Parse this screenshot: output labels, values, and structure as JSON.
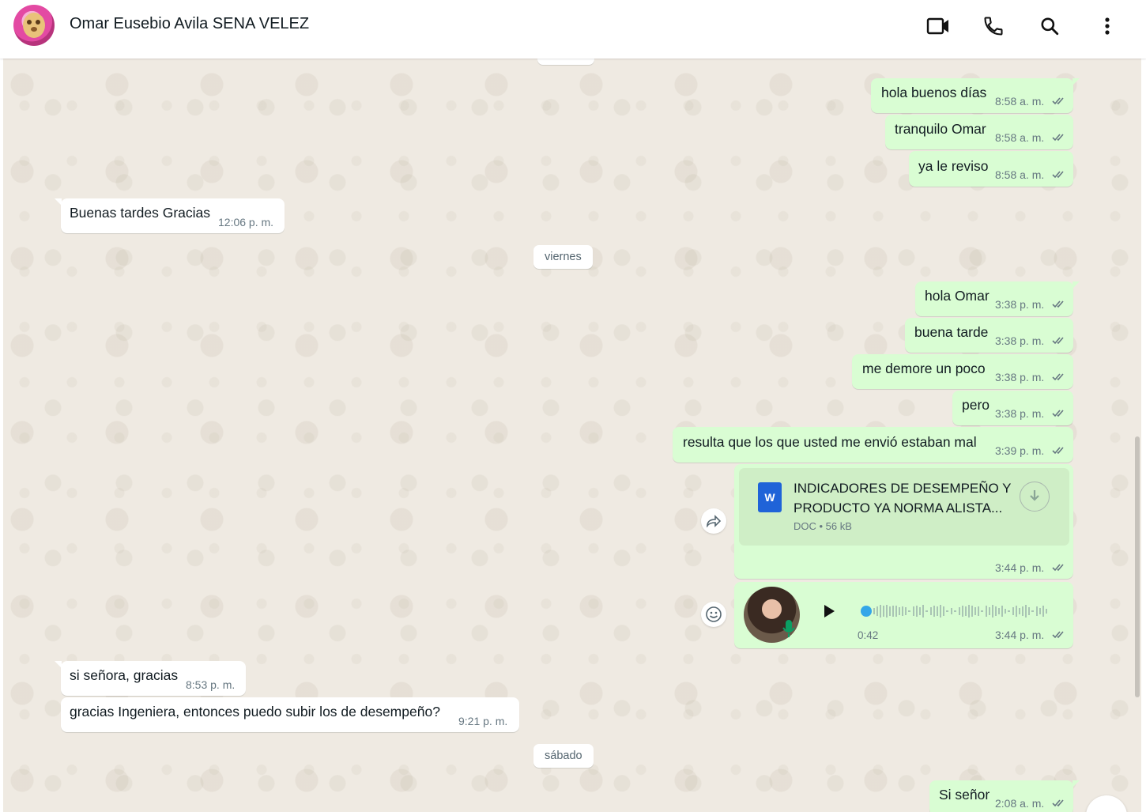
{
  "header": {
    "contact_name": "Omar Eusebio Avila SENA VELEZ",
    "icons": [
      "video-call-icon",
      "voice-call-icon",
      "search-icon",
      "menu-icon"
    ]
  },
  "colors": {
    "outgoing_bubble": "#d9fdd3",
    "incoming_bubble": "#ffffff",
    "chat_background": "#efeae2",
    "tick_color": "#667781"
  },
  "messages": {
    "m1": {
      "text": "hola buenos días",
      "time": "8:58 a. m."
    },
    "m2": {
      "text": "tranquilo Omar",
      "time": "8:58 a. m."
    },
    "m3": {
      "text": "ya le reviso",
      "time": "8:58 a. m."
    },
    "m4": {
      "text": "Buenas tardes Gracias",
      "time": "12:06 p. m."
    },
    "day1": "viernes",
    "m5": {
      "text": "hola Omar",
      "time": "3:38 p. m."
    },
    "m6": {
      "text": "buena tarde",
      "time": "3:38 p. m."
    },
    "m7": {
      "text": "me demore un poco",
      "time": "3:38 p. m."
    },
    "m8": {
      "text": "pero",
      "time": "3:38 p. m."
    },
    "m9": {
      "text": "resulta que los que usted me envió estaban mal",
      "time": "3:39 p. m."
    },
    "doc": {
      "title_line1": "INDICADORES DE DESEMPEÑO Y",
      "title_line2": "PRODUCTO YA NORMA ALISTA...",
      "meta": "DOC • 56 kB",
      "badge": "W",
      "time": "3:44 p. m."
    },
    "audio": {
      "duration": "0:42",
      "time": "3:44 p. m."
    },
    "m10": {
      "text": "si señora, gracias",
      "time": "8:53 p. m."
    },
    "m11": {
      "text": "gracias Ingeniera, entonces puedo subir los de desempeño?",
      "time": "9:21 p. m."
    },
    "day2": "sábado",
    "m12": {
      "text": "Si señor",
      "time": "2:08 a. m."
    }
  }
}
